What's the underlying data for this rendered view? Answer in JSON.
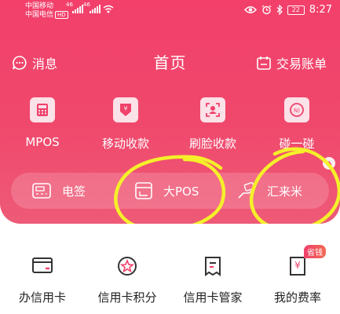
{
  "status_bar": {
    "carrier_1": "中国移动",
    "carrier_2": "中国电信",
    "hd_tag": "HD",
    "signal_tag_1": "46",
    "signal_tag_2": "46",
    "battery": "22",
    "time": "8:27"
  },
  "header": {
    "messages_label": "消息",
    "title": "首页",
    "bills_label": "交易账单"
  },
  "quick_functions": [
    {
      "label": "MPOS",
      "icon": "calculator-icon"
    },
    {
      "label": "移动收款",
      "icon": "yuan-download-icon"
    },
    {
      "label": "刷脸收款",
      "icon": "face-scan-icon"
    },
    {
      "label": "碰一碰",
      "icon": "nfc-icon"
    }
  ],
  "terminal_bar": [
    {
      "label": "电签",
      "icon": "terminal-icon"
    },
    {
      "label": "大POS",
      "icon": "pos-machine-icon"
    },
    {
      "label": "汇来米",
      "icon": "hand-card-icon"
    }
  ],
  "services": [
    {
      "label": "办信用卡",
      "icon": "credit-card-icon"
    },
    {
      "label": "信用卡积分",
      "icon": "star-badge-icon"
    },
    {
      "label": "信用卡管家",
      "icon": "clipboard-icon"
    },
    {
      "label": "我的费率",
      "icon": "yuan-receipt-icon",
      "badge": "省钱"
    }
  ],
  "colors": {
    "brand_pink": "#f2406b",
    "highlight_yellow": "#f5f02a"
  }
}
